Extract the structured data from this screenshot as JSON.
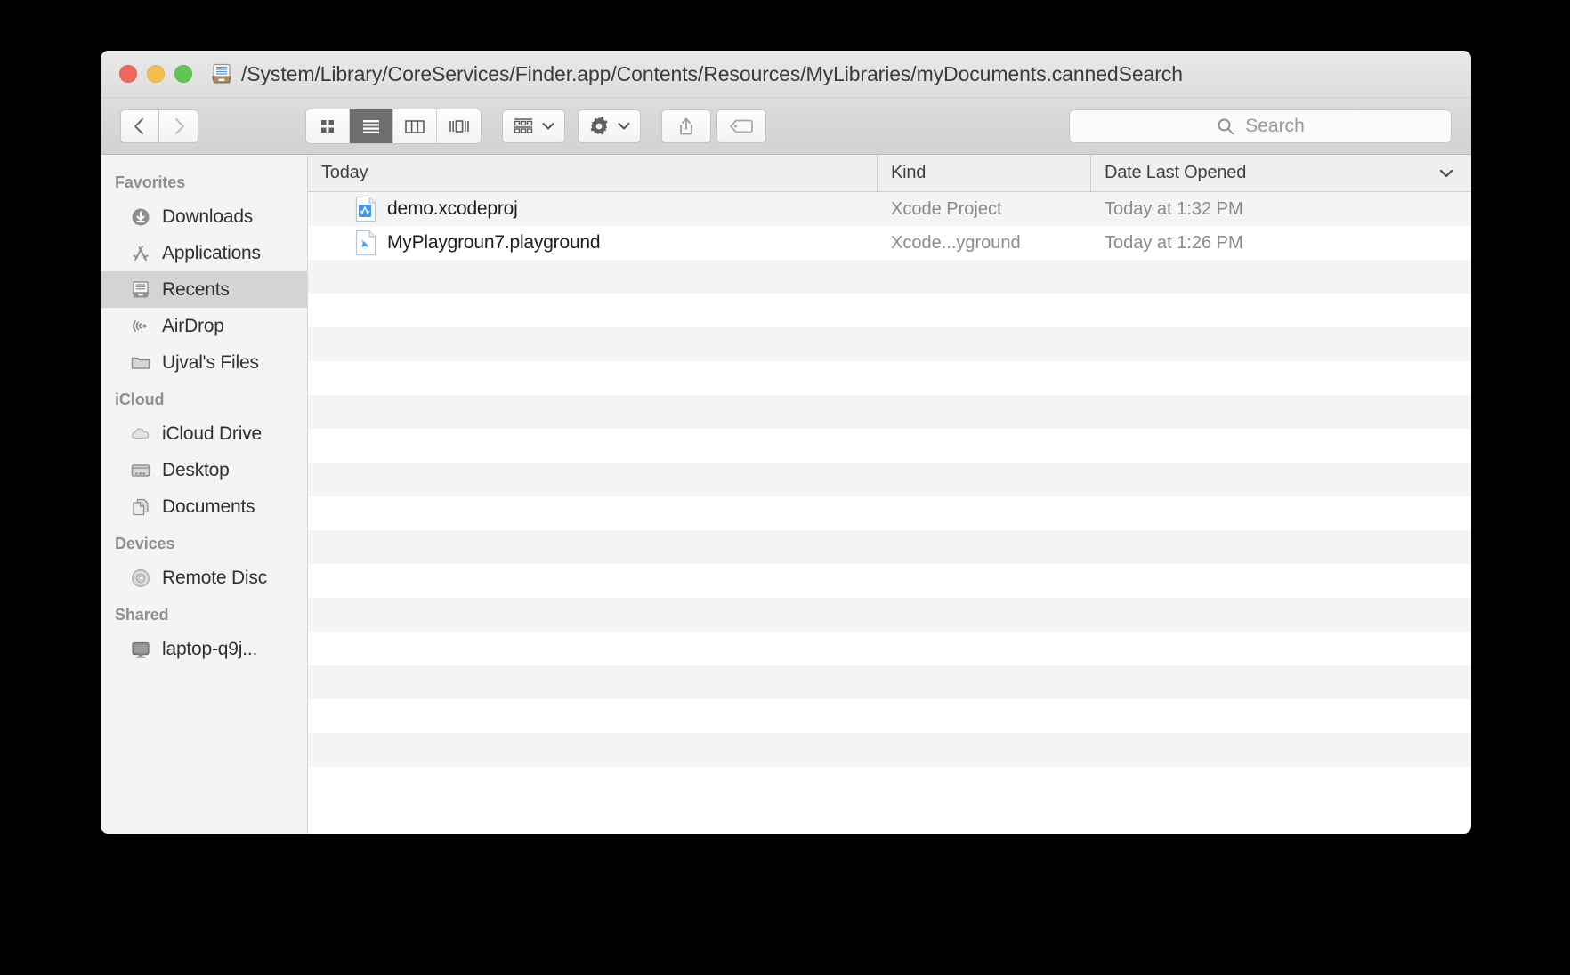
{
  "window": {
    "title": "/System/Library/CoreServices/Finder.app/Contents/Resources/MyLibraries/myDocuments.cannedSearch",
    "title_icon": "recents-box-icon",
    "traffic_lights": {
      "close": "close-button",
      "minimize": "minimize-button",
      "maximize": "maximize-button",
      "close_color": "#ee6a5f",
      "minimize_color": "#f5bd4f",
      "maximize_color": "#61c454"
    }
  },
  "toolbar": {
    "back": "back-button",
    "forward": "forward-button",
    "view_modes": [
      {
        "name": "icon-view",
        "icon": "grid-icon",
        "active": false
      },
      {
        "name": "list-view",
        "icon": "list-icon",
        "active": true
      },
      {
        "name": "column-view",
        "icon": "columns-icon",
        "active": false
      },
      {
        "name": "gallery-view",
        "icon": "gallery-icon",
        "active": false
      }
    ],
    "arrange": {
      "name": "arrange-button",
      "icon": "arrange-grid-icon"
    },
    "action": {
      "name": "action-button",
      "icon": "gear-icon"
    },
    "share": {
      "name": "share-button",
      "icon": "share-icon"
    },
    "tags": {
      "name": "tags-button",
      "icon": "tag-icon"
    },
    "search": {
      "placeholder": "Search",
      "value": "",
      "icon": "search-icon"
    }
  },
  "sidebar": {
    "sections": [
      {
        "header": "Favorites",
        "items": [
          {
            "label": "Downloads",
            "icon": "downloads-icon",
            "selected": false
          },
          {
            "label": "Applications",
            "icon": "applications-icon",
            "selected": false
          },
          {
            "label": "Recents",
            "icon": "recents-icon",
            "selected": true
          },
          {
            "label": "AirDrop",
            "icon": "airdrop-icon",
            "selected": false
          },
          {
            "label": "Ujval's Files",
            "icon": "folder-icon",
            "selected": false
          }
        ]
      },
      {
        "header": "iCloud",
        "items": [
          {
            "label": "iCloud Drive",
            "icon": "cloud-icon",
            "selected": false
          },
          {
            "label": "Desktop",
            "icon": "desktop-icon",
            "selected": false
          },
          {
            "label": "Documents",
            "icon": "documents-icon",
            "selected": false
          }
        ]
      },
      {
        "header": "Devices",
        "items": [
          {
            "label": "Remote Disc",
            "icon": "disc-icon",
            "selected": false
          }
        ]
      },
      {
        "header": "Shared",
        "items": [
          {
            "label": "laptop-q9j...",
            "icon": "computer-icon",
            "selected": false
          }
        ]
      }
    ]
  },
  "filelist": {
    "columns": [
      {
        "label": "Today",
        "name": "column-name"
      },
      {
        "label": "Kind",
        "name": "column-kind"
      },
      {
        "label": "Date Last Opened",
        "name": "column-date"
      }
    ],
    "sort_indicator": "chevron-down-icon",
    "rows": [
      {
        "name": "demo.xcodeproj",
        "icon": "xcode-project-icon",
        "kind": "Xcode Project",
        "date": "Today at 1:32 PM"
      },
      {
        "name": "MyPlaygroun7.playground",
        "icon": "swift-playground-icon",
        "kind": "Xcode...yground",
        "date": "Today at 1:26 PM"
      }
    ],
    "empty_row_count": 16
  }
}
